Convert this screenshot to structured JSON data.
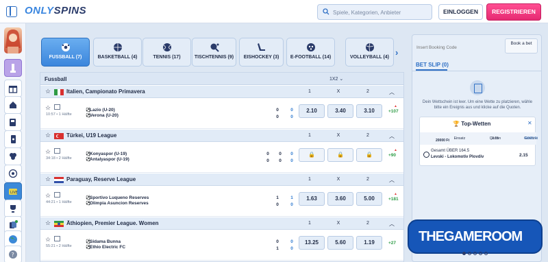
{
  "header": {
    "logo_a": "ONLY",
    "logo_b": "SPINS",
    "search_placeholder": "Spiele, Kategorien, Anbieter",
    "login_label": "EINLOGGEN",
    "register_label": "REGISTRIEREN"
  },
  "sidebar": {
    "icons": [
      "avatar",
      "tower-icon",
      "gift-icon",
      "home-icon",
      "slot-icon",
      "phone-icon",
      "clover-icon",
      "soccer-icon",
      "live-icon",
      "trophy-icon",
      "cards-icon",
      "globe-icon",
      "help-icon"
    ]
  },
  "sport_tabs": [
    {
      "label": "FUSSBALL (7)",
      "icon": "soccer-ball-icon",
      "active": true
    },
    {
      "label": "BASKETBALL (4)",
      "icon": "basketball-icon",
      "active": false
    },
    {
      "label": "TENNIS (17)",
      "icon": "tennis-ball-icon",
      "active": false
    },
    {
      "label": "TISCHTENNIS (9)",
      "icon": "table-tennis-icon",
      "active": false
    },
    {
      "label": "EISHOCKEY (3)",
      "icon": "ice-hockey-icon",
      "active": false
    },
    {
      "label": "E-FOOTBALL (14)",
      "icon": "gamepad-icon",
      "active": false
    },
    {
      "label": "VOLLEYBALL (4)",
      "icon": "volleyball-icon",
      "active": false
    }
  ],
  "events": {
    "title": "Fussball",
    "market": "1X2",
    "col_1": "1",
    "col_x": "X",
    "col_2": "2",
    "leagues": [
      {
        "name": "Italien, Campionato Primavera",
        "flag": "italy",
        "match": {
          "time": "10:57 • 1 Hälfte",
          "home": "Lazio (U-20)",
          "away": "Verona (U-20)",
          "score_home": "0",
          "score_home_half": "0",
          "score_away": "0",
          "score_away_half": "0",
          "odd1": "2.10",
          "oddx": "3.40",
          "odd2": "3.10",
          "more": "+107"
        }
      },
      {
        "name": "Türkei, U19 League",
        "flag": "turkey",
        "match": {
          "time": "34:18 • 2 Hälfte",
          "home": "Konyaspor (U-19)",
          "away": "Antalyaspor (U-19)",
          "score_home": "0",
          "score_home_half": "0",
          "score_away": "0",
          "score_away_half": "0",
          "odd1": "",
          "oddx": "",
          "odd2": "",
          "more": "+90"
        }
      },
      {
        "name": "Paraguay, Reserve League",
        "flag": "paraguay",
        "match": {
          "time": "44:21 • 1 Hälfte",
          "home": "Sportivo Luqueno Reserves",
          "away": "Olimpia Asuncion Reserves",
          "score_home": "1",
          "score_home_half": "1",
          "score_away": "0",
          "score_away_half": "0",
          "odd1": "1.63",
          "oddx": "3.60",
          "odd2": "5.00",
          "more": "+181"
        }
      },
      {
        "name": "Äthiopien, Premier League. Women",
        "flag": "ethiopia",
        "match": {
          "time": "55:21 • 2 Hälfte",
          "home": "Sidama Bunna",
          "away": "Ethio Electric FC",
          "score_home": "0",
          "score_home_half": "0",
          "score_away": "1",
          "score_away_half": "0",
          "odd1": "13.25",
          "oddx": "5.60",
          "odd2": "1.19",
          "more": "+27"
        }
      }
    ]
  },
  "bet_slip": {
    "booking_placeholder": "Insert Booking Code",
    "book_label": "Book a bet",
    "title": "BET SLIP (0)",
    "empty_message": "Dein Wettschein ist leer. Um eine Wette zu platzieren, wähle bitte ein Ereignis aus und klicke auf die Quoten.",
    "top_title": "Top-Wetten",
    "stake_label": "Einsatz",
    "stake_value": "20000 Ft",
    "odds_label": "Quoten",
    "odds_value": "2.15",
    "win_label": "Gewinne",
    "win_value": "43000 Ft",
    "selection": "Gesamt ÜBER 164.5",
    "selection_event": "Levski - Lokomotiv Plovdiv",
    "selection_odd": "2.15"
  },
  "watermark": "THEGAMEROOM"
}
